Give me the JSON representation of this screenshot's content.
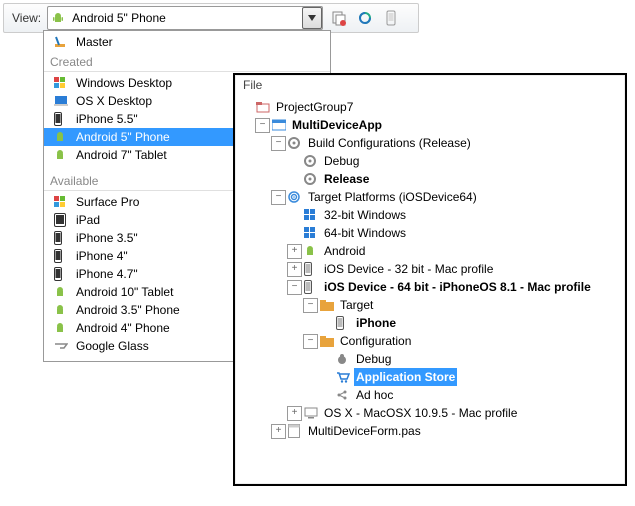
{
  "toolbar": {
    "label": "View:",
    "combo_value": "Android 5\" Phone"
  },
  "dropdown": {
    "master": "Master",
    "grp_created": "Created",
    "created": [
      "Windows Desktop",
      "OS X Desktop",
      "iPhone 5.5\"",
      "Android 5\" Phone",
      "Android 7\" Tablet"
    ],
    "grp_available": "Available",
    "available": [
      "Surface Pro",
      "iPad",
      "iPhone 3.5\"",
      "iPhone 4\"",
      "iPhone 4.7\"",
      "Android 10\" Tablet",
      "Android 3.5\" Phone",
      "Android 4\" Phone",
      "Google Glass"
    ]
  },
  "project": {
    "header": "File",
    "group": "ProjectGroup7",
    "app": "MultiDeviceApp",
    "build_conf": "Build Configurations (Release)",
    "debug": "Debug",
    "release": "Release",
    "target_platforms": "Target Platforms (iOSDevice64)",
    "win32": "32-bit Windows",
    "win64": "64-bit Windows",
    "android": "Android",
    "ios32": "iOS Device - 32 bit - Mac profile",
    "ios64": "iOS Device - 64 bit - iPhoneOS 8.1 - Mac profile",
    "target": "Target",
    "iphone": "iPhone",
    "configuration": "Configuration",
    "cfg_debug": "Debug",
    "cfg_appstore": "Application Store",
    "cfg_adhoc": "Ad hoc",
    "osx": "OS X - MacOSX 10.9.5 - Mac profile",
    "form": "MultiDeviceForm.pas"
  }
}
